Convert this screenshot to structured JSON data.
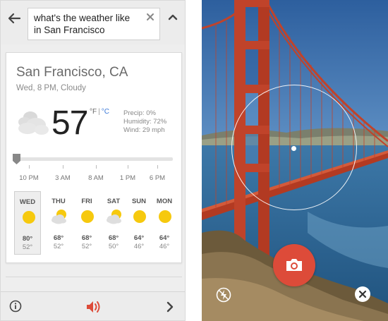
{
  "search": {
    "query": "what's the weather like in San Francisco",
    "back_icon": "arrow-left-icon",
    "clear_icon": "close-icon",
    "collapse_icon": "chevron-up-icon"
  },
  "weather": {
    "location": "San Francisco, CA",
    "condition": "Wed, 8 PM, Cloudy",
    "temperature": "57",
    "unit_f": "°F",
    "unit_sep": "|",
    "unit_c": "°C",
    "precip": "Precip: 0%",
    "humidity": "Humidity: 72%",
    "wind": "Wind: 29 mph",
    "current_icon": "cloud-icon",
    "slider_position": 0,
    "times": [
      "10 PM",
      "3 AM",
      "8 AM",
      "1 PM",
      "6 PM"
    ],
    "forecast": [
      {
        "day": "WED",
        "hi": "80°",
        "lo": "52°",
        "icon": "sunny-icon",
        "selected": true
      },
      {
        "day": "THU",
        "hi": "68°",
        "lo": "52°",
        "icon": "partly-cloudy-icon",
        "selected": false
      },
      {
        "day": "FRI",
        "hi": "68°",
        "lo": "52°",
        "icon": "sunny-icon",
        "selected": false
      },
      {
        "day": "SAT",
        "hi": "68°",
        "lo": "50°",
        "icon": "partly-cloudy-icon",
        "selected": false
      },
      {
        "day": "SUN",
        "hi": "64°",
        "lo": "46°",
        "icon": "sunny-icon",
        "selected": false
      },
      {
        "day": "MON",
        "hi": "64°",
        "lo": "46°",
        "icon": "sunny-icon",
        "selected": false
      }
    ]
  },
  "bottom_bar": {
    "info_icon": "info-icon",
    "speaker_icon": "speaker-icon",
    "next_icon": "chevron-right-icon"
  },
  "camera": {
    "capture_icon": "camera-icon",
    "flash_icon": "flash-off-icon",
    "close_icon": "close-icon",
    "accent_color": "#dd4b39"
  },
  "colors": {
    "sun": "#f6c90e",
    "celsius_link": "#3a78d8",
    "speaker": "#dd4b39"
  }
}
